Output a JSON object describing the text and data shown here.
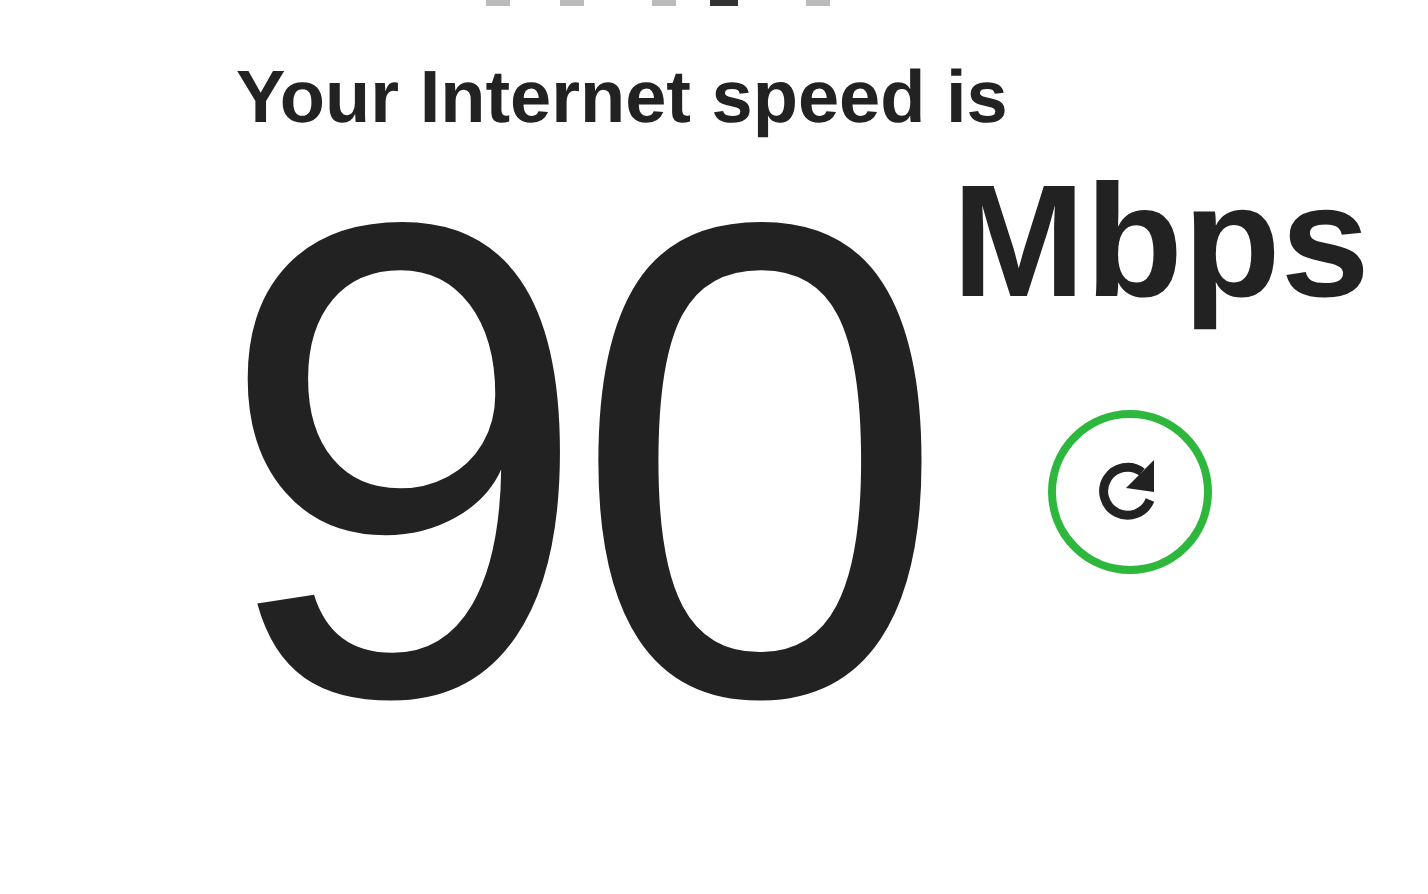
{
  "heading": "Your Internet speed is",
  "speed": {
    "value": "90",
    "unit": "Mbps"
  }
}
